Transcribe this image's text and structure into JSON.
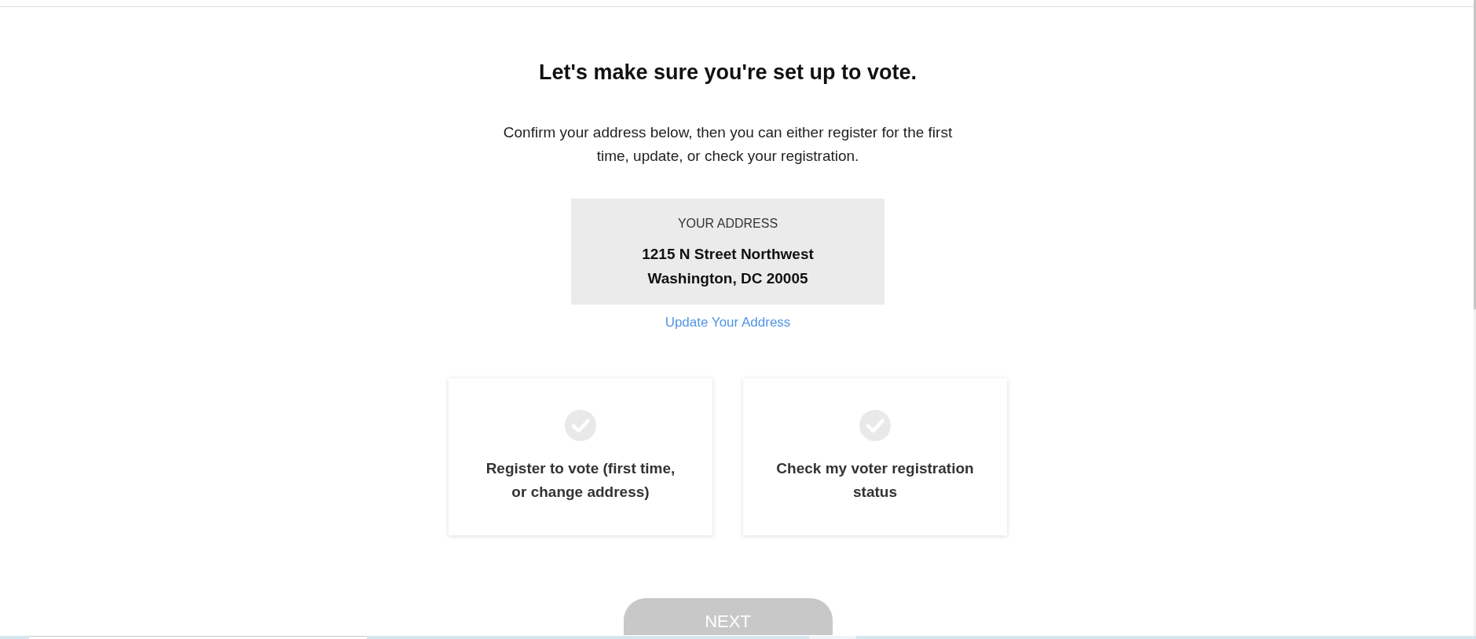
{
  "heading": "Let's make sure you're set up to vote.",
  "intro": "Confirm your address below, then you can either register for the first time, update, or check your registration.",
  "address_card": {
    "label": "YOUR ADDRESS",
    "lines": [
      "1215 N Street Northwest",
      "Washington, DC 20005"
    ]
  },
  "update_link": "Update Your Address",
  "options": [
    {
      "label": "Register to vote (first time, or change address)",
      "selected": false
    },
    {
      "label": "Check my voter registration status",
      "selected": false
    }
  ],
  "next_button": {
    "label": "NEXT",
    "disabled": true
  }
}
